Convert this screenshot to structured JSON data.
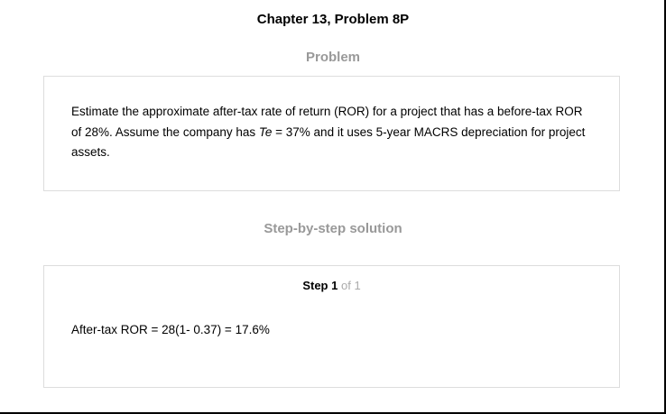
{
  "page": {
    "chapter_title": "Chapter 13, Problem 8P"
  },
  "problem": {
    "heading": "Problem",
    "text_part1": "Estimate the approximate after-tax rate of return (ROR) for a project that has a before-tax ROR of 28%. Assume the company has ",
    "text_var": "Te",
    "text_part2": " = 37% and it uses 5-year MACRS depreciation for project assets."
  },
  "solution": {
    "heading": "Step-by-step solution",
    "step": {
      "label": "Step",
      "current": "1",
      "of_text": "of 1",
      "content": "After-tax ROR = 28(1- 0.37) = 17.6%"
    }
  },
  "colors": {
    "heading_gray": "#999999",
    "card_border": "#dddddd",
    "step_of_gray": "#aaaaaa"
  }
}
